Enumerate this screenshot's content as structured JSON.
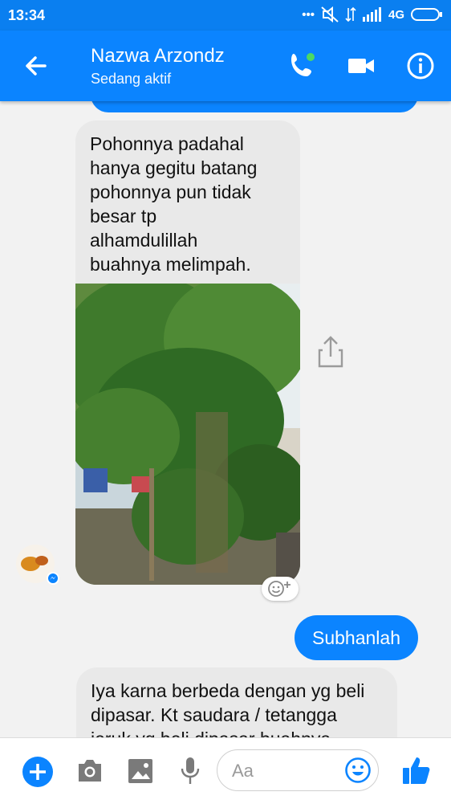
{
  "status_bar": {
    "time": "13:34",
    "network": "4G"
  },
  "header": {
    "contact_name": "Nazwa Arzondz",
    "status": "Sedang aktif"
  },
  "messages": {
    "received_1": "Pohonnya padahal\nhanya gegitu batang\npohonnya pun tidak\nbesar tp\nalhamdulillah\nbuahnya melimpah.",
    "sent_1": "Subhanlah",
    "received_2": "Iya karna berbeda dengan yg beli\ndipasar.  Kt saudara / tetangga\njeruk yg beli dipasar buahnya"
  },
  "composer": {
    "placeholder": "Aa"
  },
  "icons": {
    "back": "arrow-left-icon",
    "call": "phone-icon",
    "video": "video-camera-icon",
    "info": "info-icon",
    "share": "share-icon",
    "reaction": "add-reaction-icon",
    "add": "plus-icon",
    "camera": "camera-icon",
    "gallery": "image-icon",
    "mic": "microphone-icon",
    "emoji": "emoji-icon",
    "like": "thumbs-up-icon"
  },
  "colors": {
    "accent": "#0b84ff",
    "bubble_received": "#e9e9e9",
    "online": "#4cd964"
  }
}
